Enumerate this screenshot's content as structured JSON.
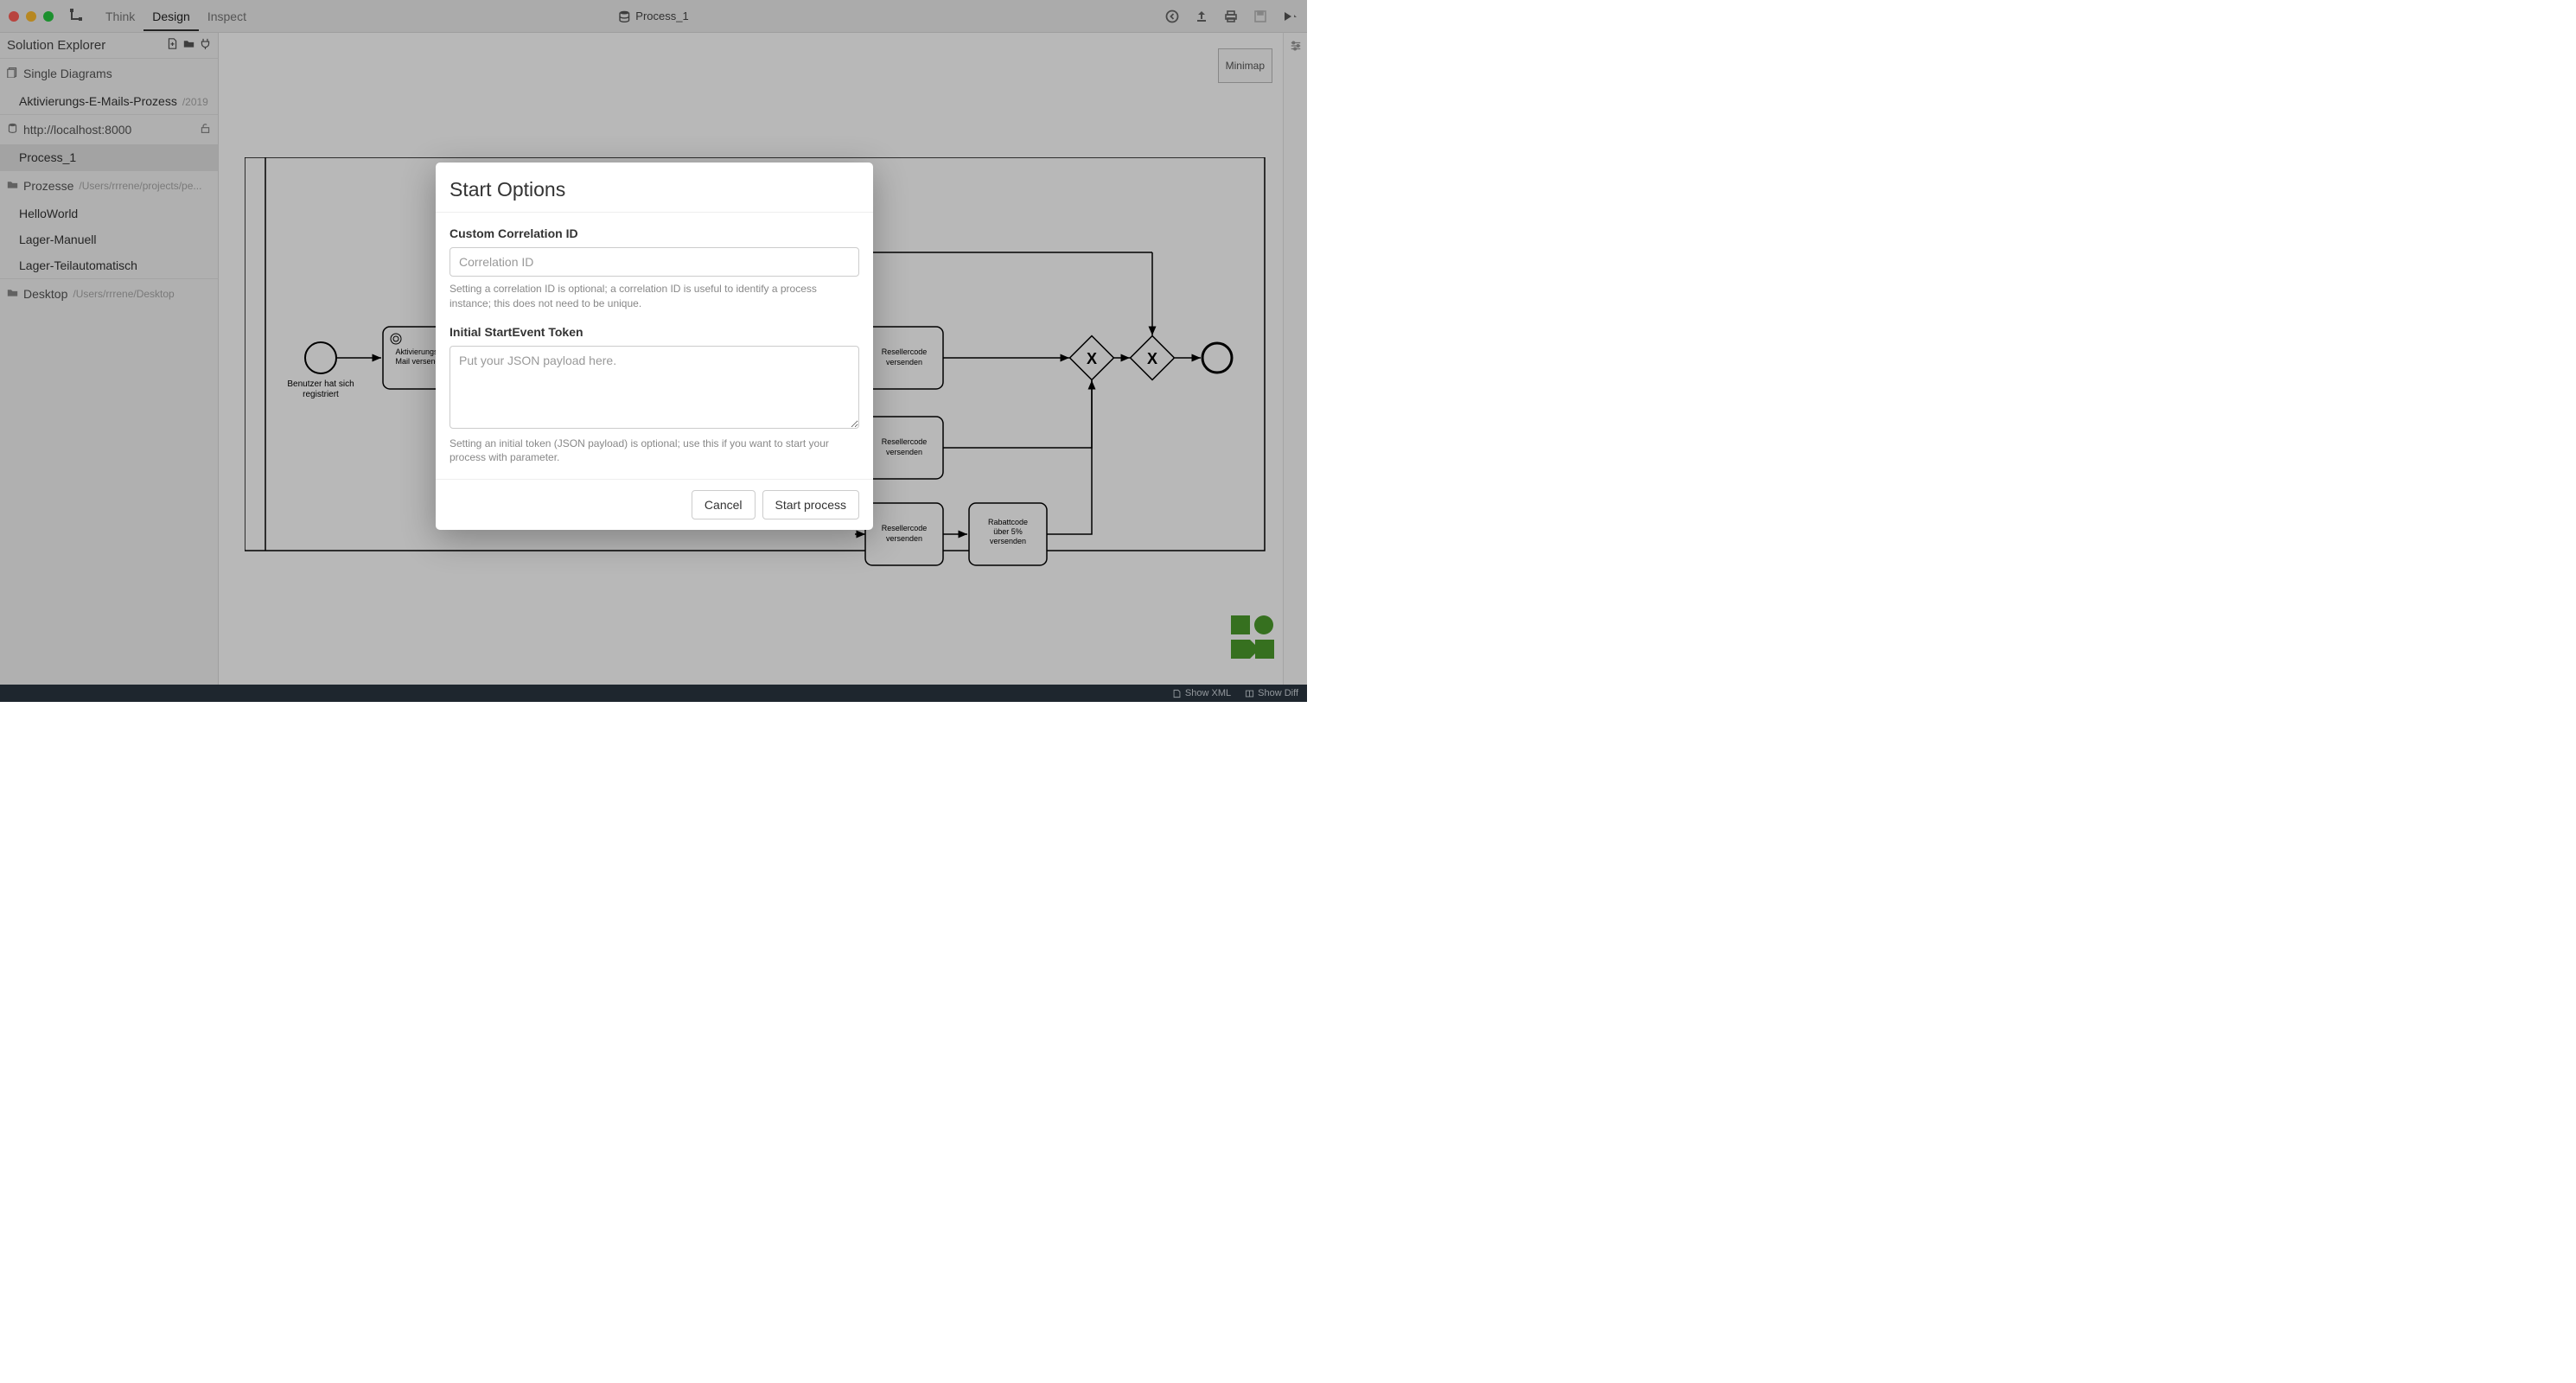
{
  "titlebar": {
    "tabs": {
      "think": "Think",
      "design": "Design",
      "inspect": "Inspect"
    },
    "title": "Process_1"
  },
  "sidebar": {
    "title": "Solution Explorer",
    "sections": {
      "single": {
        "label": "Single Diagrams"
      },
      "single_items": [
        {
          "label": "Aktivierungs-E-Mails-Prozess",
          "suffix": "/2019"
        }
      ],
      "host": {
        "label": "http://localhost:8000"
      },
      "host_items": [
        {
          "label": "Process_1"
        }
      ],
      "prozesse": {
        "label": "Prozesse",
        "path": "/Users/rrrene/projects/pe..."
      },
      "prozesse_items": [
        {
          "label": "HelloWorld"
        },
        {
          "label": "Lager-Manuell"
        },
        {
          "label": "Lager-Teilautomatisch"
        }
      ],
      "desktop": {
        "label": "Desktop",
        "path": "/Users/rrrene/Desktop"
      }
    }
  },
  "canvas": {
    "minimap": "Minimap",
    "diagram": {
      "start_label": "Benutzer hat sich registriert",
      "task1": "Aktivierungs-E-Mail versenden",
      "task_rc1": "Resellercode versenden",
      "task_rc2": "Resellercode versenden",
      "task_rc3": "Resellercode versenden",
      "task_rabatt": "Rabattcode über 5% versenden"
    }
  },
  "modal": {
    "title": "Start Options",
    "correlation": {
      "label": "Custom Correlation ID",
      "placeholder": "Correlation ID",
      "help": "Setting a correlation ID is optional; a correlation ID is useful to identify a process instance; this does not need to be unique."
    },
    "token": {
      "label": "Initial StartEvent Token",
      "placeholder": "Put your JSON payload here.",
      "help": "Setting an initial token (JSON payload) is optional; use this if you want to start your process with parameter."
    },
    "buttons": {
      "cancel": "Cancel",
      "start": "Start process"
    }
  },
  "statusbar": {
    "show_xml": "Show XML",
    "show_diff": "Show Diff"
  }
}
